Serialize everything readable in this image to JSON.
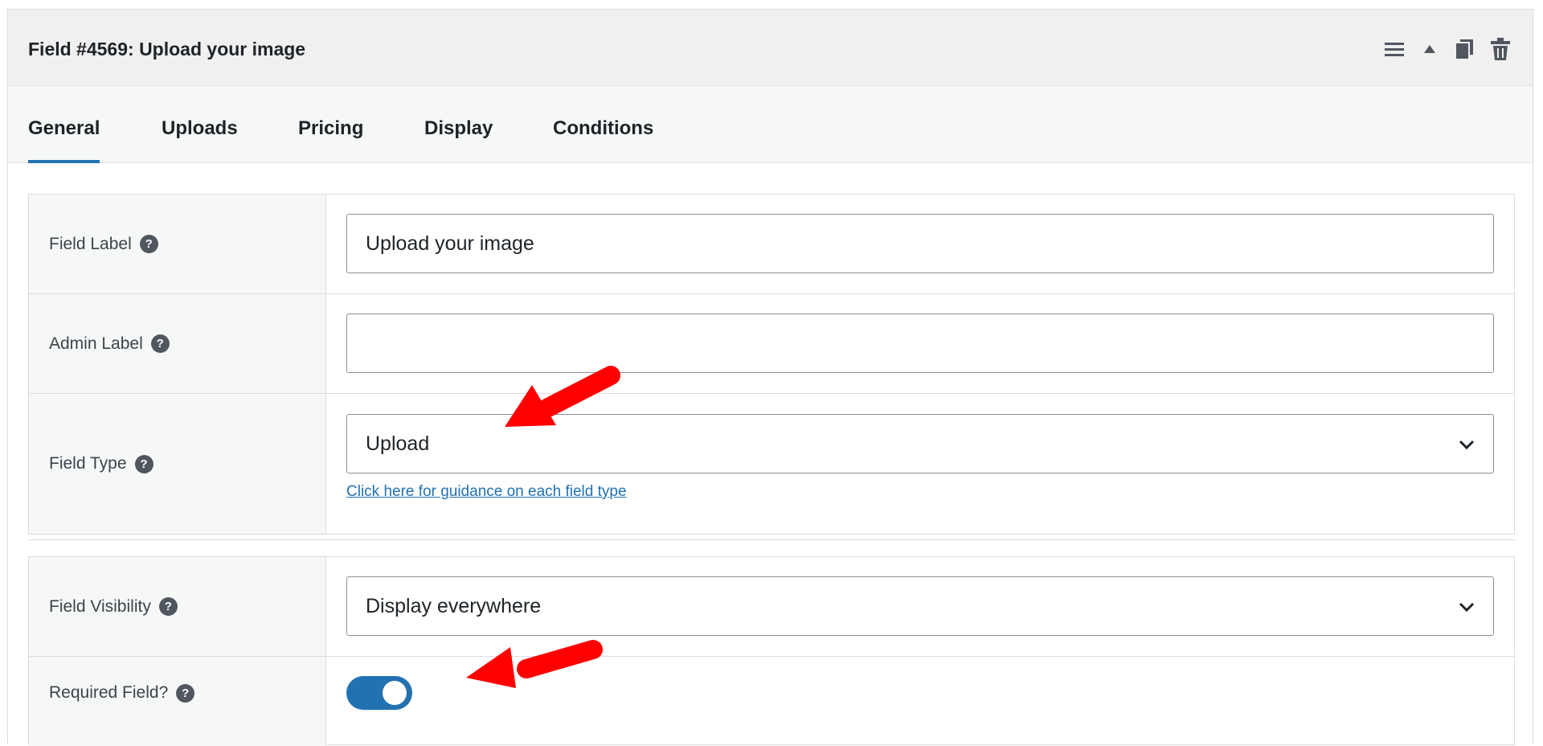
{
  "header": {
    "title": "Field #4569: Upload your image",
    "icons": [
      "hamburger-icon",
      "triangle-up-icon",
      "copy-icon",
      "trash-icon"
    ]
  },
  "tabs": [
    {
      "label": "General",
      "active": true
    },
    {
      "label": "Uploads",
      "active": false
    },
    {
      "label": "Pricing",
      "active": false
    },
    {
      "label": "Display",
      "active": false
    },
    {
      "label": "Conditions",
      "active": false
    }
  ],
  "fields": {
    "field_label": {
      "label": "Field Label",
      "value": "Upload your image"
    },
    "admin_label": {
      "label": "Admin Label",
      "value": ""
    },
    "field_type": {
      "label": "Field Type",
      "selected": "Upload",
      "guidance_link": "Click here for guidance on each field type"
    },
    "field_visibility": {
      "label": "Field Visibility",
      "selected": "Display everywhere"
    },
    "required_field": {
      "label": "Required Field?",
      "enabled": true
    }
  },
  "help_glyph": "?",
  "colors": {
    "accent": "#2271b1",
    "annotation_arrow": "#ff0000",
    "header_bg": "#f0f0f1"
  }
}
